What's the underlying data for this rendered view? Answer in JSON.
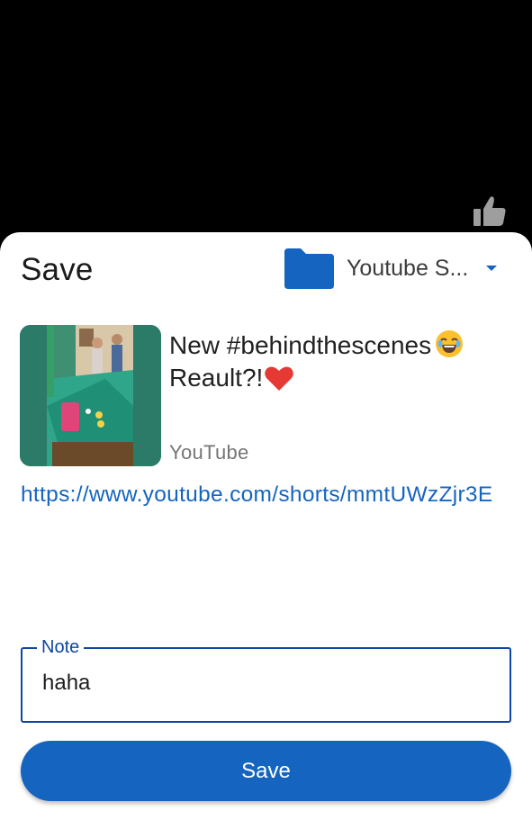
{
  "sheet": {
    "title": "Save",
    "folder": {
      "label": "Youtube S...",
      "icon": "folder-icon",
      "color": "#1565c0"
    }
  },
  "preview": {
    "title_text": "New #behindthescenes",
    "title_text_2": "Reault?!",
    "source": "YouTube",
    "url": "https://www.youtube.com/shorts/mmtUWzZjr3E"
  },
  "note": {
    "label": "Note",
    "value": "haha"
  },
  "actions": {
    "save_label": "Save",
    "accent": "#1565c0"
  },
  "background": {
    "icon": "thumb-up-icon"
  }
}
